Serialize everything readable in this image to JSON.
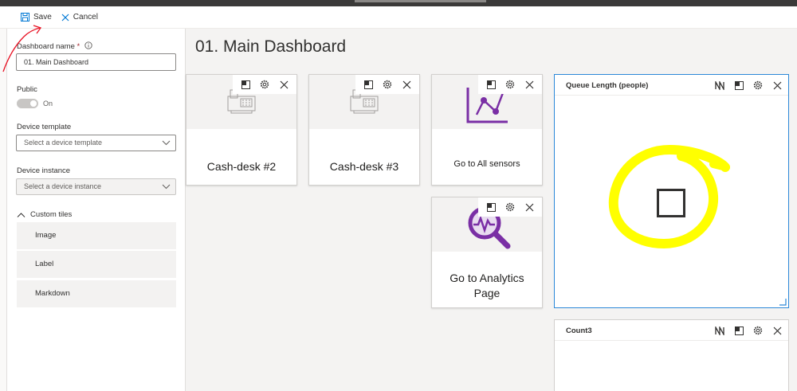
{
  "toolbar": {
    "save_label": "Save",
    "cancel_label": "Cancel"
  },
  "panel": {
    "dashboard_name_label": "Dashboard name",
    "required_mark": "*",
    "dashboard_name_value": "01. Main Dashboard",
    "public_label": "Public",
    "public_state": "On",
    "device_template_label": "Device template",
    "device_template_placeholder": "Select a device template",
    "device_instance_label": "Device instance",
    "device_instance_placeholder": "Select a device instance",
    "custom_tiles_label": "Custom tiles",
    "custom_tiles": [
      "Image",
      "Label",
      "Markdown"
    ]
  },
  "dashboard": {
    "title": "01. Main Dashboard",
    "tiles": [
      {
        "caption": "Cash-desk #2",
        "icon": "cash-register-icon"
      },
      {
        "caption": "Cash-desk #3",
        "icon": "cash-register-icon"
      },
      {
        "caption": "Go to All sensors",
        "icon": "chart-line-icon"
      },
      {
        "caption": "Go to Analytics Page",
        "icon": "analytics-search-icon"
      }
    ],
    "queue_tile_title": "Queue Length (people)",
    "count_tile_title": "Count3"
  },
  "colors": {
    "accent": "#0078d4",
    "purple": "#7a2fa5",
    "highlight": "#ffff00",
    "annotation": "#e81123"
  }
}
